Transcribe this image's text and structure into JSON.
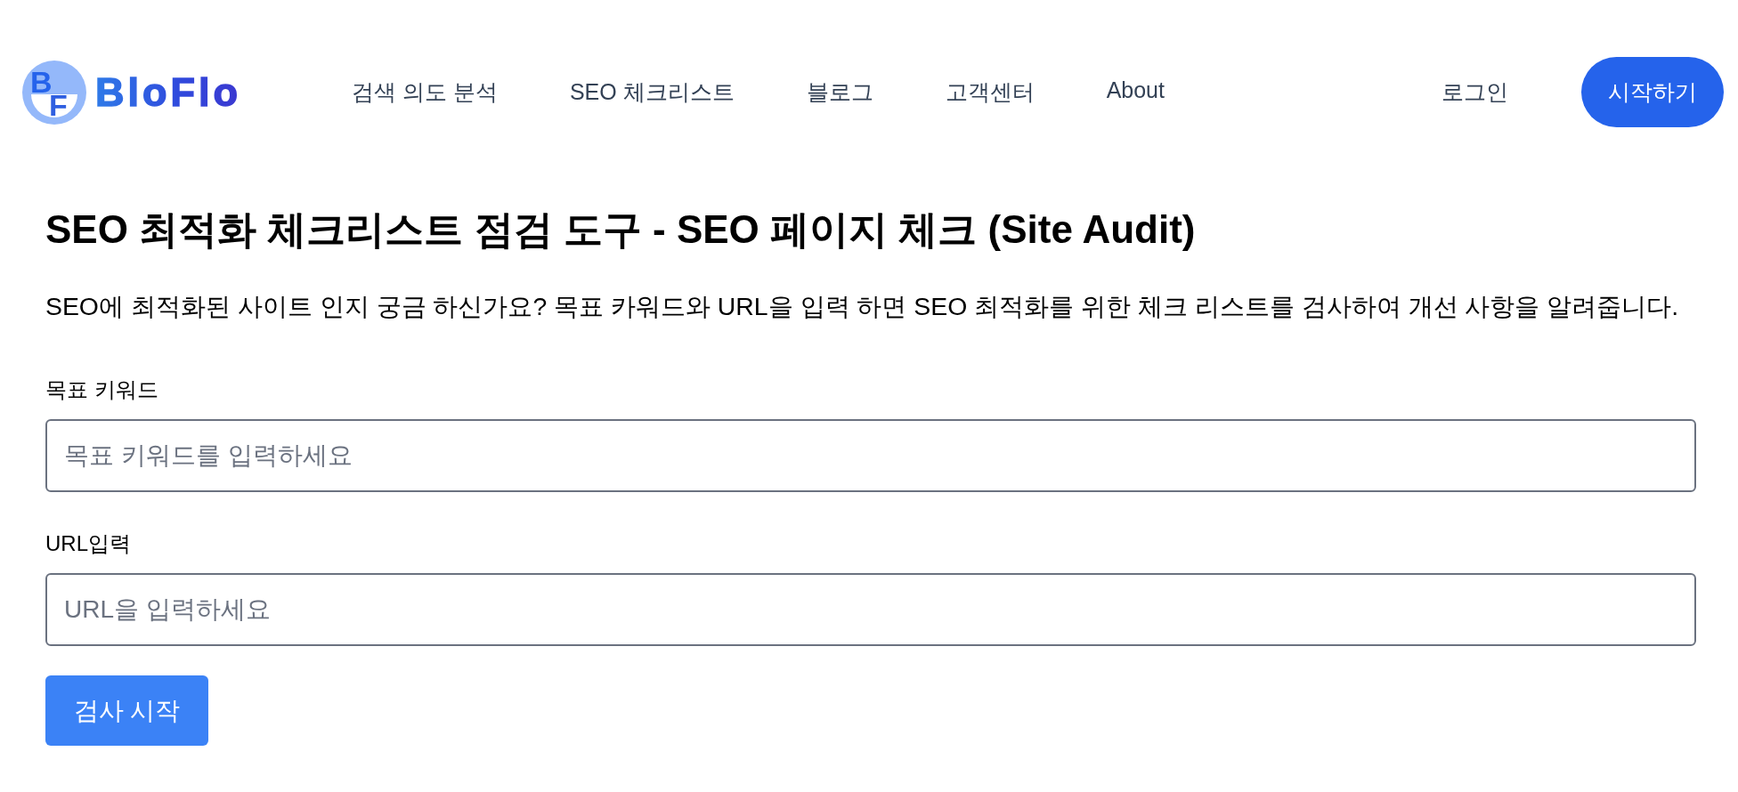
{
  "header": {
    "logo": {
      "monogram": [
        "B",
        "F"
      ],
      "wordmark": "BloFlo"
    },
    "nav": [
      "검색 의도 분석",
      "SEO 체크리스트",
      "블로그",
      "고객센터",
      "About"
    ],
    "login": "로그인",
    "cta": "시작하기"
  },
  "main": {
    "title": "SEO 최적화 체크리스트 점검 도구 - SEO 페이지 체크 (Site Audit)",
    "description": "SEO에 최적화된 사이트 인지 궁금 하신가요? 목표 카워드와 URL을 입력 하면 SEO 최적화를 위한 체크 리스트를 검사하여 개선 사항을 알려줍니다.",
    "fields": [
      {
        "label": "목표 키워드",
        "placeholder": "목표 키워드를 입력하세요"
      },
      {
        "label": "URL입력",
        "placeholder": "URL을 입력하세요"
      }
    ],
    "submit": "검사 시작"
  }
}
